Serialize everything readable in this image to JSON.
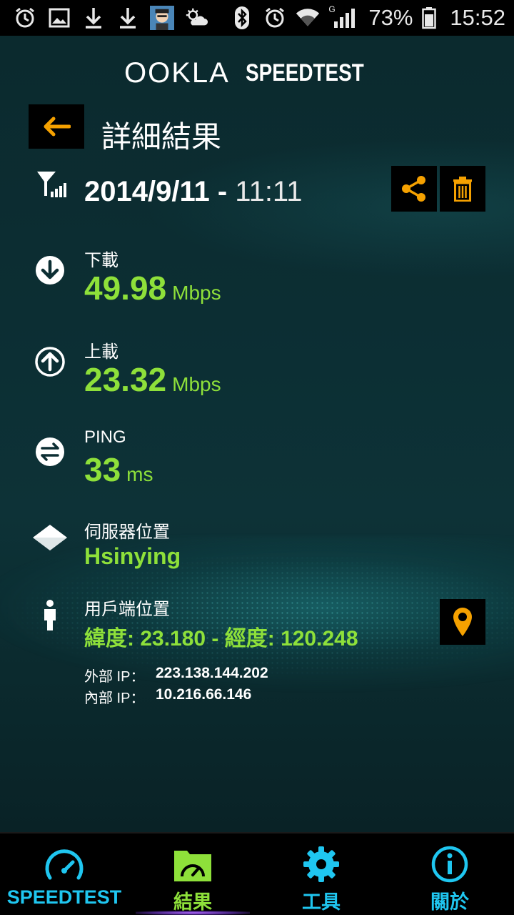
{
  "status_bar": {
    "left_icons": [
      "alarm-icon",
      "gallery-icon",
      "download-icon",
      "download-icon",
      "avatar-icon",
      "weather-icon"
    ],
    "right_icons": [
      "bluetooth-icon",
      "alarm-icon",
      "wifi-icon",
      "signal-icon"
    ],
    "network_type": "G",
    "battery_percent": "73%",
    "time": "15:52"
  },
  "header": {
    "logo_left": "OOKLA",
    "logo_right": "SPEEDTEST",
    "back_icon": "back-arrow-icon",
    "title": "詳細結果"
  },
  "result": {
    "connection_icon": "cellular-signal-icon",
    "date": "2014/9/11",
    "separator": " - ",
    "time": "11:11",
    "download": {
      "label": "下載",
      "value": "49.98",
      "unit": "Mbps"
    },
    "upload": {
      "label": "上載",
      "value": "23.32",
      "unit": "Mbps"
    },
    "ping": {
      "label": "PING",
      "value": "33",
      "unit": "ms"
    },
    "server": {
      "label": "伺服器位置",
      "value": "Hsinying"
    },
    "client": {
      "label": "用戶端位置",
      "value": "緯度: 23.180 - 經度: 120.248"
    },
    "external_ip": {
      "label": "外部 IP：",
      "value": "223.138.144.202"
    },
    "internal_ip": {
      "label": "內部 IP：",
      "value": "10.216.66.146"
    }
  },
  "nav": {
    "items": [
      {
        "label": "SPEEDTEST",
        "icon": "speedometer-icon",
        "active": false
      },
      {
        "label": "結果",
        "icon": "results-folder-icon",
        "active": true
      },
      {
        "label": "工具",
        "icon": "gear-icon",
        "active": false
      },
      {
        "label": "關於",
        "icon": "info-icon",
        "active": false
      }
    ]
  },
  "colors": {
    "accent_green": "#8ee03a",
    "accent_orange": "#f5a100",
    "accent_cyan": "#1fc6f0"
  }
}
